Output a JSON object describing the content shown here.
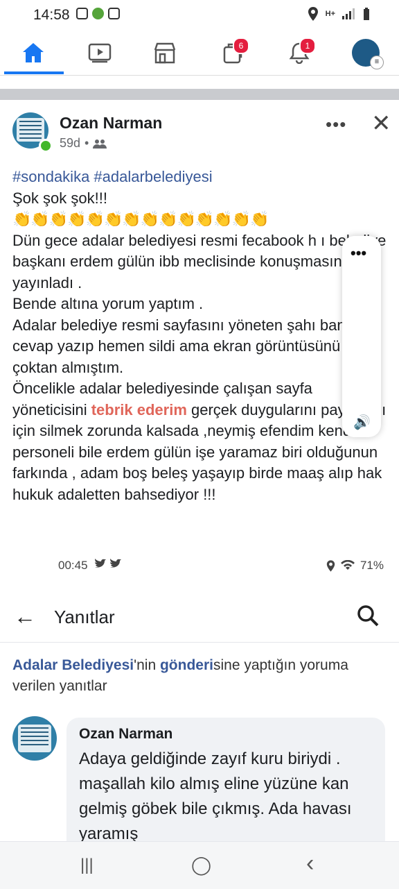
{
  "status_bar": {
    "time": "14:58",
    "right_text": "H+"
  },
  "nav": {
    "badges": {
      "pages": "6",
      "notifications": "1"
    },
    "icons": [
      "home-icon",
      "video-icon",
      "marketplace-icon",
      "pages-icon",
      "bell-icon",
      "profile-menu-icon"
    ],
    "accent": "#1877f2"
  },
  "post": {
    "author": "Ozan Narman",
    "time": "59d",
    "separator": "•",
    "tags": "#sondakika #adalarbelediyesi",
    "line1": "Şok şok şok!!!",
    "claps": "👏👏👏👏👏👏👏👏👏👏👏👏👏👏",
    "p1": "Dün gece adalar belediyesi resmi fecabook h    ı belediye başkanı erdem gülün ibb meclisinde konuşmasını yayınladı .",
    "p2": "Bende altına yorum yaptım .",
    "p3": "Adalar belediye resmi sayfasını yöneten şahı bana cevap yazıp hemen sildi ama ekran görüntüsünü çoktan almıştım.",
    "p4_before": "Öncelikle adalar belediyesinde çalışan sayfa yöneticisini ",
    "p4_highlight": "tebrik ederim",
    "p4_after": " gerçek duygularını paylaştığı için silmek zorunda kalsada ,neymiş efendim kendi personeli bile erdem gülün işe yaramaz biri olduğunun farkında , adam boş beleş yaşayıp birde maaş alıp hak hukuk adaletten bahsediyor !!!"
  },
  "inner_status": {
    "time": "00:45",
    "battery": "71%"
  },
  "replies": {
    "title": "Yanıtlar",
    "page_name": "Adalar Belediyesi",
    "mid1": "'nin ",
    "post_word": "gönderi",
    "rest": "sine yaptığın yoruma verilen yanıtlar"
  },
  "comment": {
    "author": "Ozan Narman",
    "text": "Adaya geldiğinde zayıf kuru biriydi . maşallah kilo almış eline yüzüne kan gelmiş göbek bile çıkmış. Ada havası yaramış"
  },
  "bottom_nav": {
    "recents": "|||",
    "home": "◯",
    "back": "‹"
  }
}
